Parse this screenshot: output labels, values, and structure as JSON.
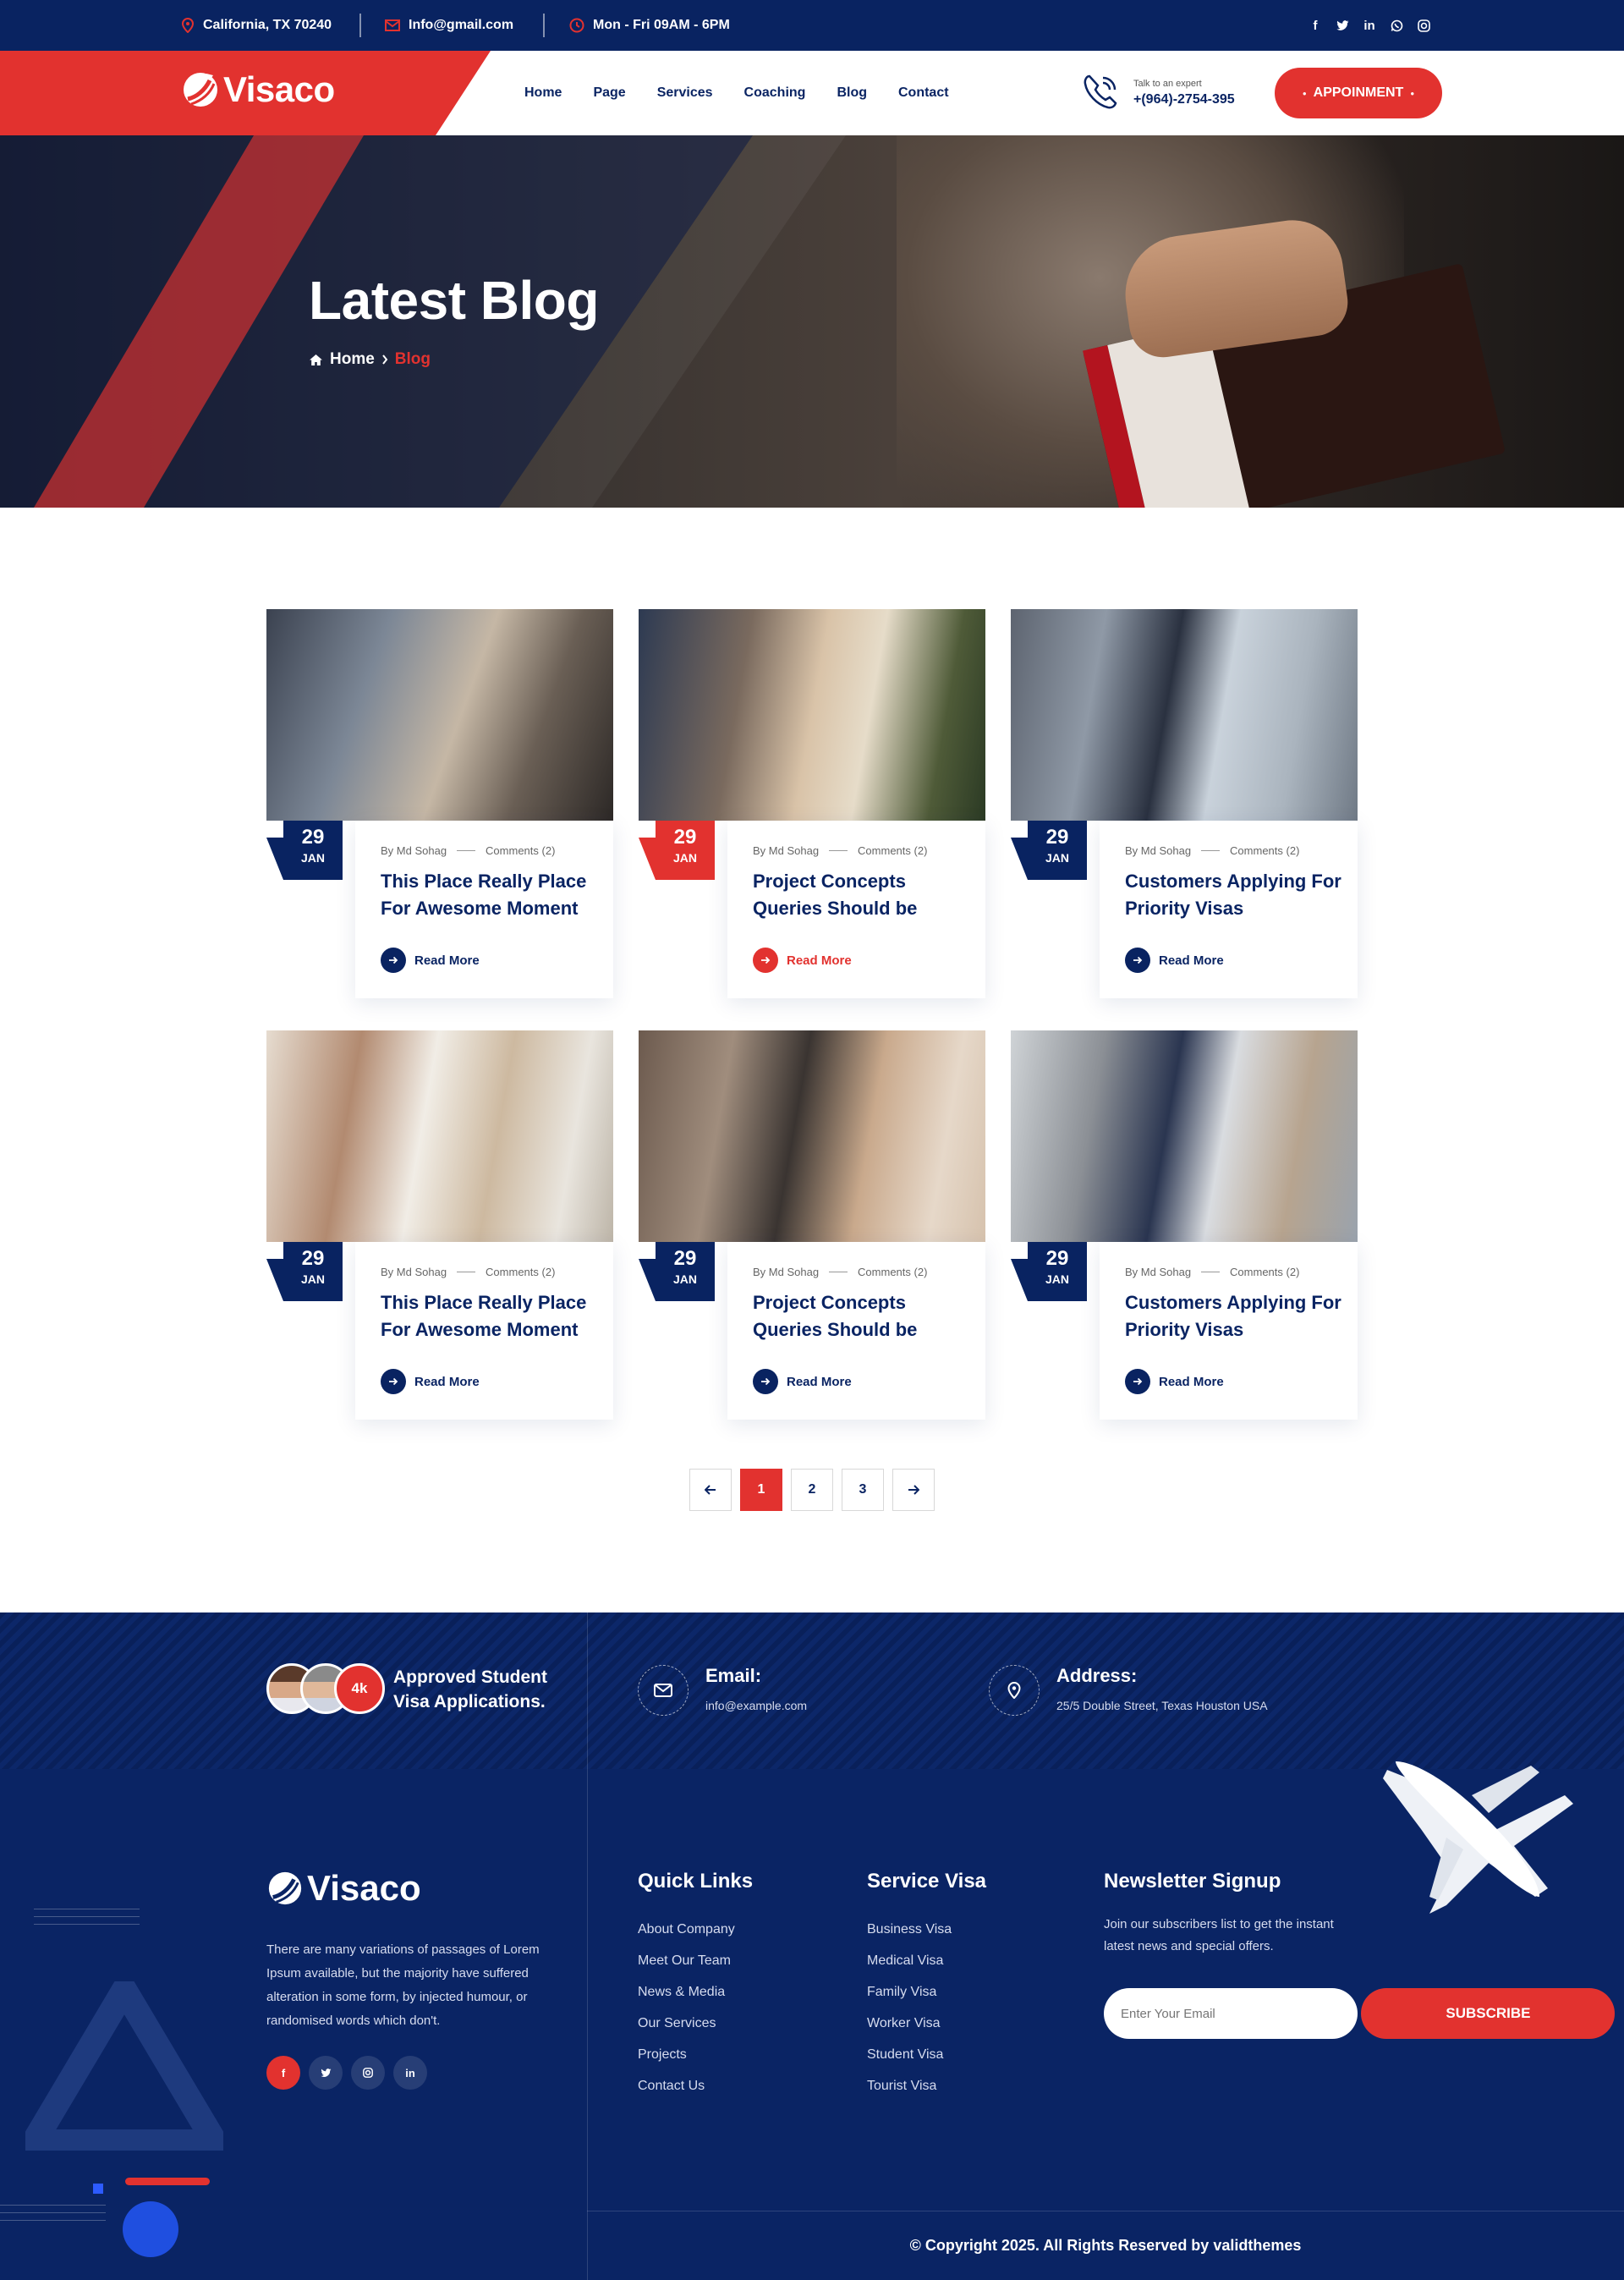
{
  "topbar": {
    "location": "California, TX 70240",
    "email": "Info@gmail.com",
    "hours": "Mon - Fri  09AM - 6PM",
    "social": [
      "f",
      "t",
      "in",
      "wa",
      "ig"
    ]
  },
  "header": {
    "brand": "Visaco",
    "nav": [
      "Home",
      "Page",
      "Services",
      "Coaching",
      "Blog",
      "Contact"
    ],
    "expert_label": "Talk to an expert",
    "expert_phone": "+(964)-2754-395",
    "appointment": "APPOINMENT"
  },
  "hero": {
    "title": "Latest Blog",
    "breadcrumb_home": "Home",
    "breadcrumb_current": "Blog"
  },
  "posts": [
    {
      "day": "29",
      "month": "JAN",
      "author": "By Md Sohag",
      "comments": "Comments (2)",
      "title": "This Place Really Place For Awesome Moment",
      "read": "Read More",
      "accent": "navy"
    },
    {
      "day": "29",
      "month": "JAN",
      "author": "By Md Sohag",
      "comments": "Comments (2)",
      "title": "Project Concepts Queries Should be",
      "read": "Read More",
      "accent": "red"
    },
    {
      "day": "29",
      "month": "JAN",
      "author": "By Md Sohag",
      "comments": "Comments (2)",
      "title": "Customers Applying For Priority Visas",
      "read": "Read More",
      "accent": "navy"
    },
    {
      "day": "29",
      "month": "JAN",
      "author": "By Md Sohag",
      "comments": "Comments (2)",
      "title": "This Place Really Place For Awesome Moment",
      "read": "Read More",
      "accent": "navy"
    },
    {
      "day": "29",
      "month": "JAN",
      "author": "By Md Sohag",
      "comments": "Comments (2)",
      "title": "Project Concepts Queries Should be",
      "read": "Read More",
      "accent": "navy"
    },
    {
      "day": "29",
      "month": "JAN",
      "author": "By Md Sohag",
      "comments": "Comments (2)",
      "title": "Customers Applying For Priority Visas",
      "read": "Read More",
      "accent": "navy"
    }
  ],
  "pagination": {
    "pages": [
      "1",
      "2",
      "3"
    ],
    "active": "1"
  },
  "footer": {
    "approved_count": "4k",
    "approved_text": "Approved Student Visa Applications.",
    "email_label": "Email:",
    "email_value": "info@example.com",
    "address_label": "Address:",
    "address_value": "25/5 Double Street, Texas Houston USA",
    "brand": "Visaco",
    "about": "There are many variations of passages of Lorem Ipsum available, but the majority have suffered alteration in some form, by injected humour, or randomised words which don't.",
    "social": [
      "f",
      "t",
      "ig",
      "in"
    ],
    "quick_links_title": "Quick Links",
    "quick_links": [
      "About Company",
      "Meet Our Team",
      "News & Media",
      "Our Services",
      "Projects",
      "Contact Us"
    ],
    "service_title": "Service Visa",
    "services": [
      "Business Visa",
      "Medical Visa",
      "Family Visa",
      "Worker Visa",
      "Student Visa",
      "Tourist Visa"
    ],
    "newsletter_title": "Newsletter Signup",
    "newsletter_text": "Join our subscribers list to get the instant latest news and special offers.",
    "newsletter_placeholder": "Enter Your Email",
    "subscribe": "SUBSCRIBE",
    "copyright": "© Copyright 2025. All Rights Reserved by validthemes"
  },
  "colors": {
    "navy": "#092361",
    "red": "#e2322f"
  }
}
